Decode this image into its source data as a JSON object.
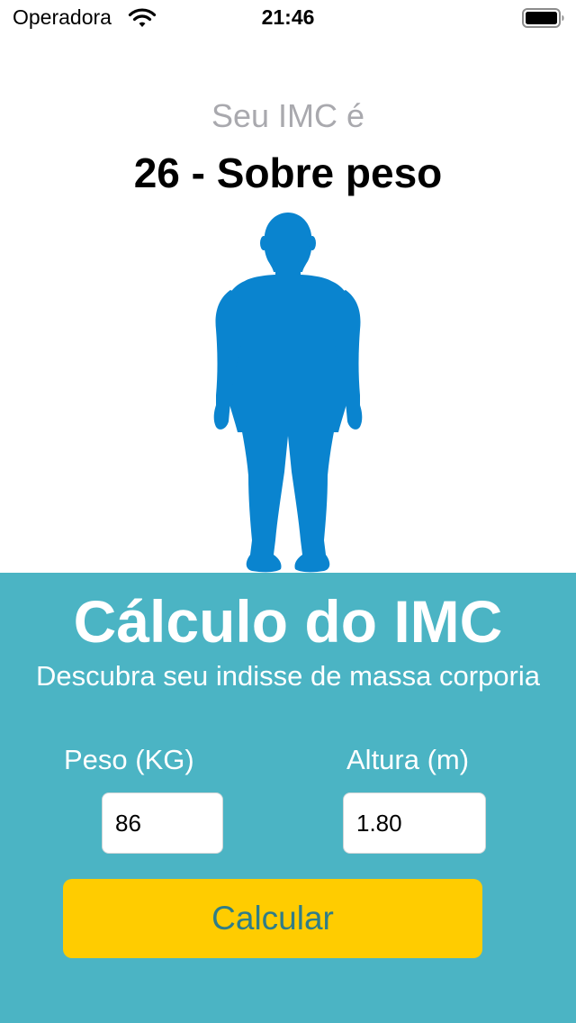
{
  "status_bar": {
    "carrier": "Operadora",
    "time": "21:46"
  },
  "result": {
    "caption": "Seu IMC é",
    "value": "26 - Sobre peso"
  },
  "calculator": {
    "title": "Cálculo do IMC",
    "subtitle": "Descubra seu indisse de massa corporia",
    "weight_label": "Peso (KG)",
    "weight_value": "86",
    "height_label": "Altura (m)",
    "height_value": "1.80",
    "button_label": "Calcular"
  },
  "colors": {
    "panel": "#4bb4c4",
    "button": "#ffcc00",
    "button_text": "#2f7d88",
    "figure": "#0a84cf",
    "caption": "#a9a9ae"
  },
  "icons": {
    "wifi": "wifi-icon",
    "battery": "battery-icon",
    "figure": "person-silhouette-icon"
  }
}
